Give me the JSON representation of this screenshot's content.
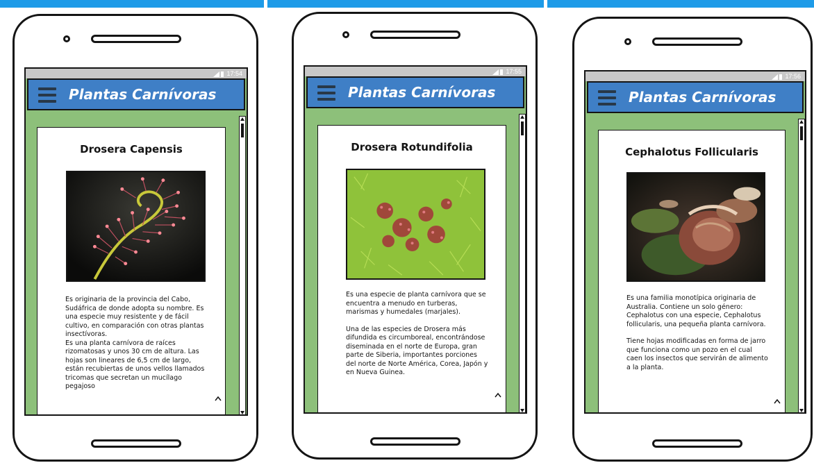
{
  "app_title": "Plantas Carnívoras",
  "status_time": [
    "17:54",
    "17:55",
    "17:56"
  ],
  "screens": [
    {
      "title": "Drosera Capensis",
      "photo_icon": "drosera-capensis-photo",
      "paragraphs": [
        "Es originaria de la provincia del Cabo, Sudáfrica de donde adopta su nombre. Es una especie muy resistente y de fácil cultivo, en comparación con otras plantas insectívoras.",
        "Es una planta carnívora de raíces rizomatosas y unos 30 cm de altura.  Las hojas son lineares de 6,5 cm de largo, están recubiertas de unos vellos llamados tricomas que secretan un mucílago pegajoso"
      ]
    },
    {
      "title": "Drosera Rotundifolia",
      "photo_icon": "drosera-rotundifolia-photo",
      "paragraphs": [
        "Es una especie de planta carnívora que se encuentra a menudo en turberas, marismas y humedales (marjales).",
        "Una de las especies de Drosera más difundida es circumboreal, encontrándose diseminada en el norte de Europa, gran parte de Siberia, importantes porciones del norte de Norte América, Corea, Japón y en Nueva Guinea."
      ]
    },
    {
      "title": "Cephalotus Follicularis",
      "photo_icon": "cephalotus-follicularis-photo",
      "paragraphs": [
        "Es una familia monotípica originaria de Australia. Contiene un solo género: Cephalotus con una especie, Cephalotus follicularis, una pequeña planta carnívora.",
        "Tiene hojas modificadas en forma de jarro que funciona como un pozo en el cual caen los insectos que servirán de alimento a la planta."
      ]
    }
  ],
  "colors": {
    "accent_bar": "#1e9be8",
    "app_bar": "#3f7fc6",
    "screen_bg": "#8dc07a",
    "status_bar": "#c8c8c8"
  }
}
